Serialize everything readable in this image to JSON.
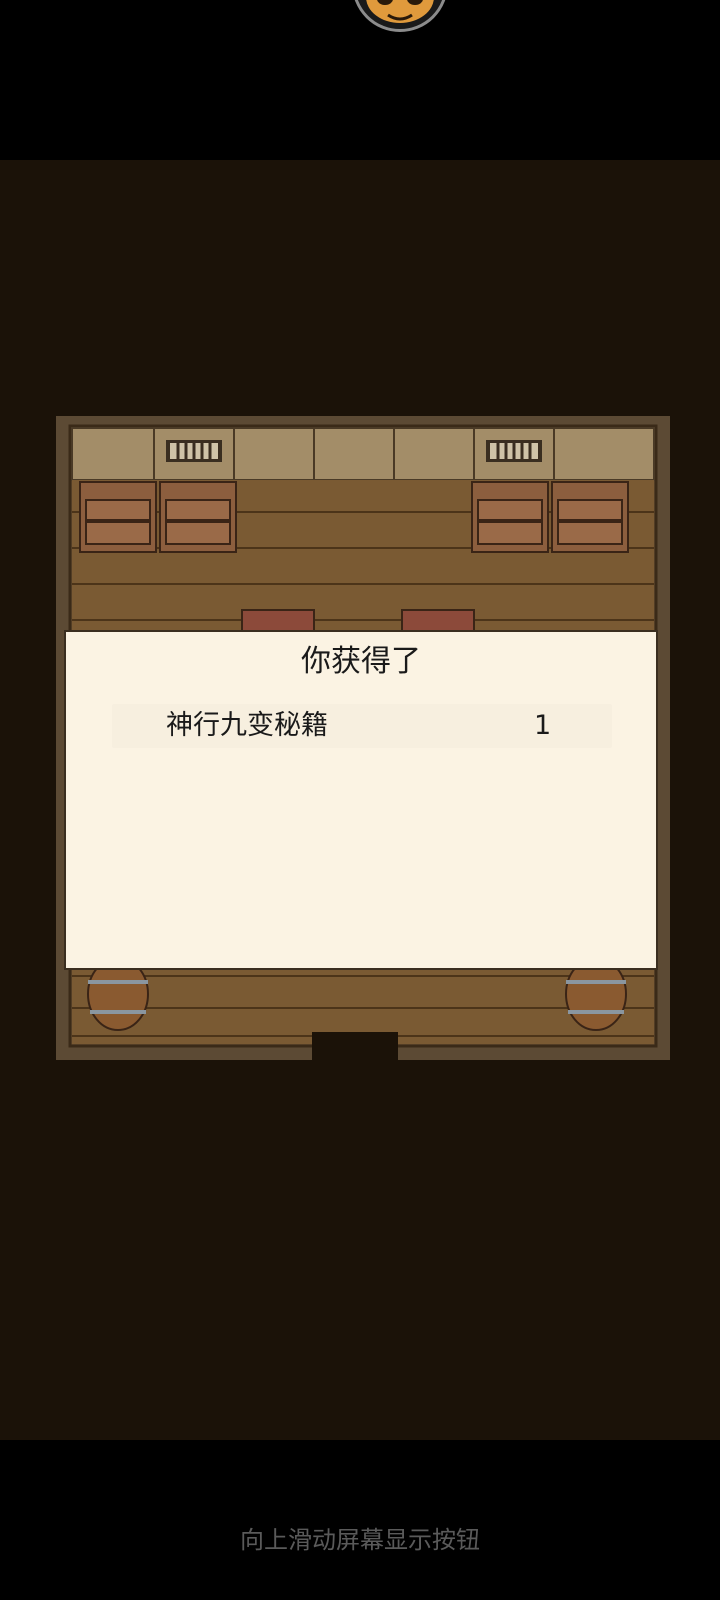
{
  "dialog": {
    "title": "你获得了",
    "items": [
      {
        "name": "神行九变秘籍",
        "count": "1"
      }
    ]
  },
  "system": {
    "swipe_hint": "向上滑动屏幕显示按钮"
  },
  "colors": {
    "game_background": "#1b1208",
    "dialog_background": "#fbf3e3",
    "floor_wood": "#7a5a33",
    "wall_panel": "#a38d68",
    "hint_text": "#5a5a5a"
  },
  "icons": {
    "avatar": "frog-avatar-icon"
  }
}
